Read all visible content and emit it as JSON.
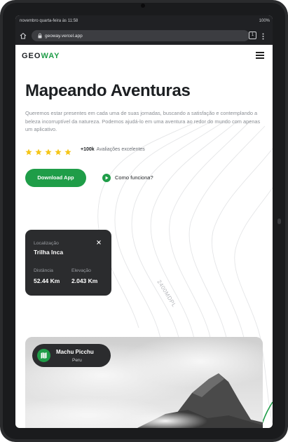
{
  "status_bar": {
    "time": "novembro quarta-feira às 11:58",
    "battery": "100%"
  },
  "browser": {
    "url": "geoway.vercel.app",
    "tab_count": "1"
  },
  "site": {
    "logo_prefix": "GEO",
    "logo_accent": "WAY"
  },
  "hero": {
    "title": "Mapeando Aventuras",
    "description": "Queremos estar presentes em cada uma de suas jornadas, buscando a satisfação e contemplando a beleza incorruptível da natureza. Podemos ajudá-lo em uma aventura ao redor do mundo com apenas um aplicativo.",
    "rating_stars": 5,
    "rating_count": "+100k",
    "rating_text": "Avaliações excelentes",
    "download_label": "Download App",
    "how_label": "Como funciona?"
  },
  "location_card": {
    "location_label": "Localização",
    "location_value": "Trilha Inca",
    "distance_label": "Distância",
    "distance_value": "52.44 Km",
    "elevation_label": "Elevação",
    "elevation_value": "2.043 Km"
  },
  "map": {
    "altitude_label": "2400MDPL"
  },
  "photo_pin": {
    "name": "Machu Picchu",
    "country": "Peru"
  },
  "colors": {
    "accent": "#1f9d48",
    "star": "#f5c518",
    "card_bg": "#2b2c2e",
    "heading": "#1c1f22"
  },
  "icons": [
    "home-icon",
    "lock-icon",
    "tabs-icon",
    "more-vert-icon",
    "hamburger-icon",
    "star-icon",
    "play-icon",
    "close-icon",
    "map-icon"
  ]
}
